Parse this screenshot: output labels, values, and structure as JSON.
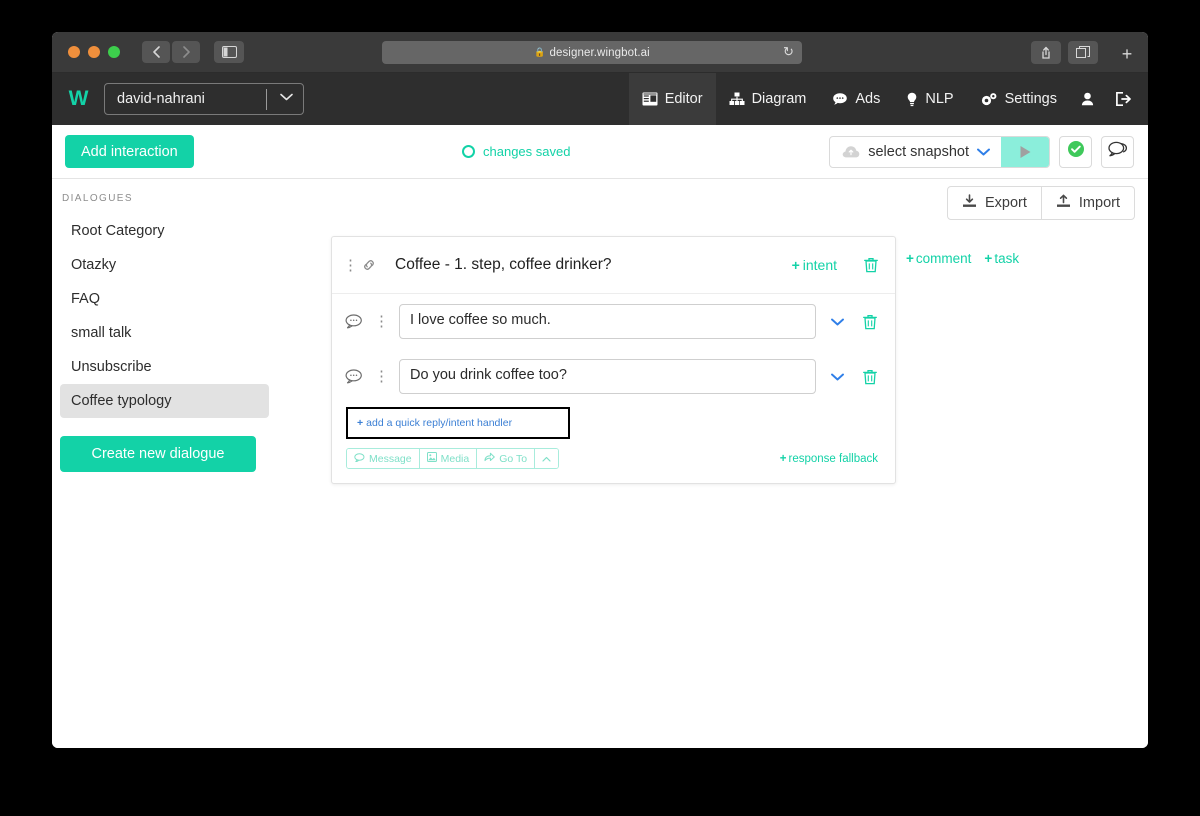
{
  "browser": {
    "url": "designer.wingbot.ai",
    "lock_icon": "lock-icon",
    "reload_icon": "reload-icon",
    "back_icon": "back-arrow-icon",
    "forward_icon": "forward-arrow-icon",
    "sidebar_icon": "sidebar-toggle-icon",
    "share_icon": "share-icon",
    "tabs_icon": "tab-overview-icon",
    "newtab_label": "+"
  },
  "appbar": {
    "logo": "W",
    "project": "david-nahrani",
    "nav": [
      {
        "label": "Editor",
        "icon": "editor-icon",
        "active": true
      },
      {
        "label": "Diagram",
        "icon": "diagram-icon",
        "active": false
      },
      {
        "label": "Ads",
        "icon": "ads-icon",
        "active": false
      },
      {
        "label": "NLP",
        "icon": "nlp-icon",
        "active": false
      },
      {
        "label": "Settings",
        "icon": "settings-icon",
        "active": false
      }
    ],
    "user_icon": "user-icon",
    "logout_icon": "logout-icon"
  },
  "toolbar": {
    "add_interaction": "Add interaction",
    "status": "changes saved",
    "snapshot_placeholder": "select snapshot",
    "cloud_icon": "cloud-upload-icon",
    "play_icon": "play-icon",
    "check_icon": "check-circle-icon",
    "chat_icon": "chat-bubbles-icon"
  },
  "sidebar": {
    "title": "DIALOGUES",
    "items": [
      {
        "label": "Root Category",
        "active": false
      },
      {
        "label": "Otazky",
        "active": false
      },
      {
        "label": "FAQ",
        "active": false
      },
      {
        "label": "small talk",
        "active": false
      },
      {
        "label": "Unsubscribe",
        "active": false
      },
      {
        "label": "Coffee typology",
        "active": true
      }
    ],
    "create_button": "Create new dialogue"
  },
  "main": {
    "export_label": "Export",
    "import_label": "Import",
    "export_icon": "download-icon",
    "import_icon": "upload-icon",
    "card": {
      "title": "Coffee - 1. step, coffee drinker?",
      "intent_label": "intent",
      "drag_icon": "drag-handle-icon",
      "link_icon": "chain-link-icon",
      "delete_icon": "trash-icon",
      "messages": [
        {
          "value": "I love coffee so much.",
          "icon": "speech-bubble-icon"
        },
        {
          "value": "Do you drink coffee too?",
          "icon": "speech-bubble-icon"
        }
      ],
      "quick_reply": "add a quick reply/intent handler",
      "actions": [
        {
          "label": "Message",
          "icon": "message-icon"
        },
        {
          "label": "Media",
          "icon": "media-icon"
        },
        {
          "label": "Go To",
          "icon": "goto-icon"
        }
      ],
      "collapse_icon": "chevron-up-icon",
      "fallback_label": "response fallback"
    },
    "side_links": [
      {
        "label": "comment"
      },
      {
        "label": "task"
      }
    ]
  },
  "colors": {
    "accent": "#13d2a7",
    "blue": "#2f7fe8",
    "chrome": "#3a3a3a",
    "appbar": "#2e2e2e"
  }
}
